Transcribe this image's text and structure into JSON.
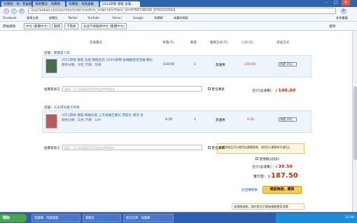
{
  "tabs": [
    {
      "label": "淘寶網 - 淘！我喜歡"
    },
    {
      "label": "我要寶貝 - 淘寶網"
    },
    {
      "label": "淘寶網 - 淘我喜歡"
    },
    {
      "label": "2011新款 春裝 女裝..."
    }
  ],
  "url": "buy.taobao.com/auction/order/confirm_order.htm?item_id=9766748340_8760343564",
  "bookmarks": [
    "Facebook",
    "蘋果日報",
    "新聞台",
    "Twitter",
    "YouTube",
    "Yahoo!",
    "Google",
    "淘寶網",
    "收藏的網頁"
  ],
  "bookmarks_right": "其他書籤",
  "translate": {
    "from_label": "原始網頁",
    "from_value": "中文 (繁體中文)",
    "translate_btn": "翻譯",
    "no_btn": "不需要",
    "never_btn": "永遠不要翻譯中文 (繁體中文)",
    "options": "選項"
  },
  "headers": [
    "店舖寶貝",
    "單價(元)",
    "數量",
    "優惠方式(元)",
    "小計(元)",
    "運送方式"
  ],
  "shop1": {
    "label": "店鋪：",
    "name": "寶寶愛人家"
  },
  "item1": {
    "title": "2011新款 春裝 女裝 韓版名店 100%純棉 長袖翻領泡泡袖 襯衫",
    "attrs": "顏色分類：深紅  尺碼：均碼",
    "price": "118.00",
    "qty": "1",
    "discount": "無優惠",
    "subtotal": "118.00",
    "ship": "快遞 10元"
  },
  "msg_label": "給賣家留言：",
  "msg_placeholder": "選填：可以告訴賣家您對商品的特殊要求",
  "anonymous": "匿名購買",
  "total1_label": "合計(含運費)：￥",
  "total1": "148.00",
  "shop2": {
    "label": "店鋪：",
    "name": "天天時尚電子商務"
  },
  "item2": {
    "title": "2011新款 春裝 韓版女裝 上衣長袖打底衫 雪紡衫 潮流 女",
    "attrs": "顏色分類：白色  尺碼：S/M",
    "price": "9.50",
    "qty": "1",
    "discount": "無優惠",
    "subtotal": "9.50",
    "ship": "快遞 20元"
  },
  "coupon_text": "店鋪該商品可以使用店鋪優惠券，使用5元優惠券可減5元",
  "points": "使用積分抵扣：",
  "total2_label": "合計(含運費)：￥",
  "total2": "39.50",
  "grand_label": "實付款：￥",
  "grand": "187.50",
  "back": "返回購物車",
  "submit": "確認無誤，購買",
  "note": "若價格變動，請在提交訂單後聯繫賣家改價",
  "taskbar": {
    "start": "開始",
    "tasks": [
      "淘寶網 - 淘我喜歡",
      "新聞台",
      "提交訂單 - 淘寶網"
    ],
    "time": "22:48"
  }
}
